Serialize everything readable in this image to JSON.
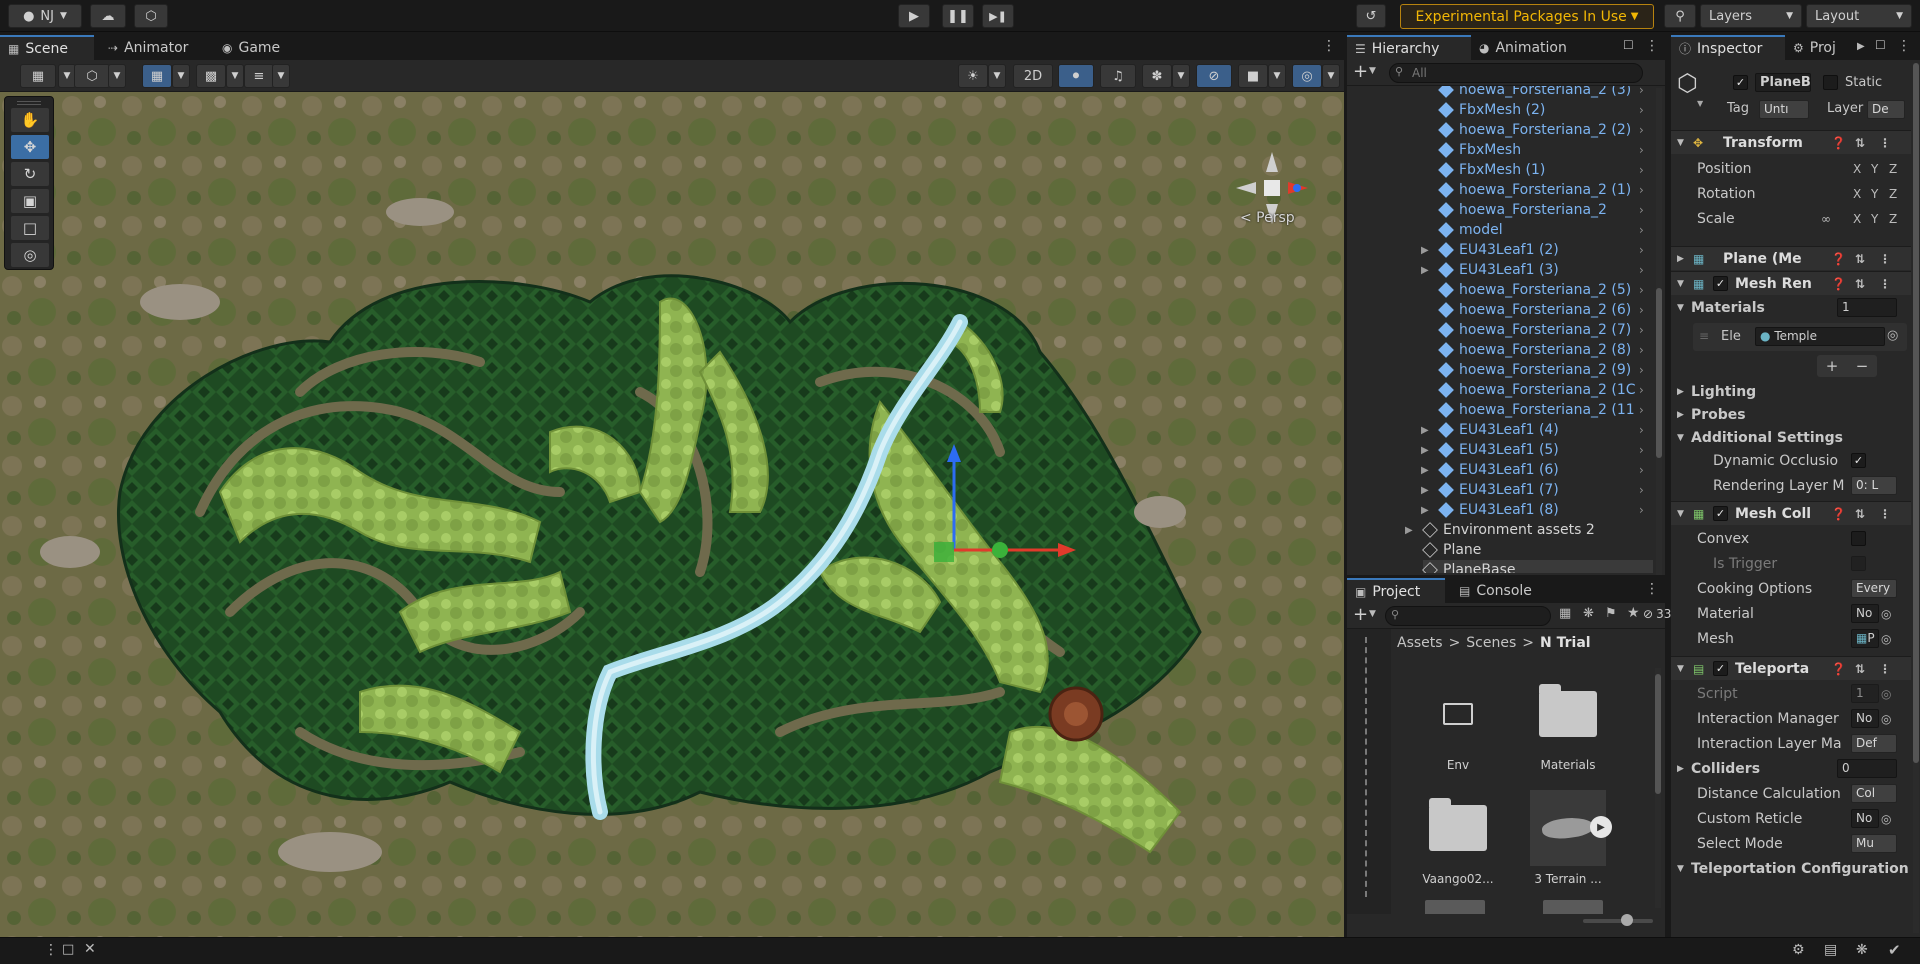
{
  "toolbar": {
    "account": "NJ",
    "experimental": "Experimental Packages In Use",
    "layers": "Layers",
    "layout": "Layout"
  },
  "scene": {
    "tabs": [
      {
        "label": "Scene",
        "icon": "scene-icon"
      },
      {
        "label": "Animator",
        "icon": "animator-icon"
      },
      {
        "label": "Game",
        "icon": "game-icon"
      }
    ],
    "mode_2d": "2D",
    "persp": "< Persp",
    "gizmo_axes": {
      "y": "y"
    }
  },
  "hierarchy": {
    "tabs": [
      "Hierarchy",
      "Animation"
    ],
    "search_placeholder": "All",
    "items": [
      {
        "label": "hoewa_Forsteriana_2 (3)",
        "type": "prefab",
        "indent": 1
      },
      {
        "label": "FbxMesh (2)",
        "type": "prefab",
        "indent": 1
      },
      {
        "label": "hoewa_Forsteriana_2 (2)",
        "type": "prefab",
        "indent": 1
      },
      {
        "label": "FbxMesh",
        "type": "prefab",
        "indent": 1
      },
      {
        "label": "FbxMesh (1)",
        "type": "prefab",
        "indent": 1
      },
      {
        "label": "hoewa_Forsteriana_2 (1)",
        "type": "prefab",
        "indent": 1
      },
      {
        "label": "hoewa_Forsteriana_2",
        "type": "prefab",
        "indent": 1
      },
      {
        "label": "model",
        "type": "prefab",
        "indent": 1
      },
      {
        "label": "EU43Leaf1 (2)",
        "type": "prefab",
        "indent": 1,
        "expandable": true
      },
      {
        "label": "EU43Leaf1 (3)",
        "type": "prefab",
        "indent": 1,
        "expandable": true
      },
      {
        "label": "hoewa_Forsteriana_2 (5)",
        "type": "prefab",
        "indent": 1
      },
      {
        "label": "hoewa_Forsteriana_2 (6)",
        "type": "prefab",
        "indent": 1
      },
      {
        "label": "hoewa_Forsteriana_2 (7)",
        "type": "prefab",
        "indent": 1
      },
      {
        "label": "hoewa_Forsteriana_2 (8)",
        "type": "prefab",
        "indent": 1
      },
      {
        "label": "hoewa_Forsteriana_2 (9)",
        "type": "prefab",
        "indent": 1
      },
      {
        "label": "hoewa_Forsteriana_2 (1C",
        "type": "prefab",
        "indent": 1
      },
      {
        "label": "hoewa_Forsteriana_2 (11",
        "type": "prefab",
        "indent": 1
      },
      {
        "label": "EU43Leaf1 (4)",
        "type": "prefab",
        "indent": 1,
        "expandable": true
      },
      {
        "label": "EU43Leaf1 (5)",
        "type": "prefab",
        "indent": 1,
        "expandable": true
      },
      {
        "label": "EU43Leaf1 (6)",
        "type": "prefab",
        "indent": 1,
        "expandable": true
      },
      {
        "label": "EU43Leaf1 (7)",
        "type": "prefab",
        "indent": 1,
        "expandable": true
      },
      {
        "label": "EU43Leaf1 (8)",
        "type": "prefab",
        "indent": 1,
        "expandable": true
      },
      {
        "label": "Environment assets 2",
        "type": "plain",
        "indent": 0,
        "expandable": true
      },
      {
        "label": "Plane",
        "type": "plain",
        "indent": 0
      },
      {
        "label": "PlaneBase",
        "type": "plain",
        "indent": 0,
        "selected": true
      }
    ]
  },
  "project": {
    "tabs": [
      "Project",
      "Console"
    ],
    "hidden_count": "33",
    "breadcrumb": [
      "Assets",
      "Scenes",
      "N Trial"
    ],
    "assets": [
      {
        "label": "Env",
        "kind": "folder-empty"
      },
      {
        "label": "Materials",
        "kind": "folder"
      },
      {
        "label": "Vaango02...",
        "kind": "folder"
      },
      {
        "label": "3 Terrain ...",
        "kind": "model"
      }
    ]
  },
  "inspector": {
    "tabs": [
      "Inspector",
      "Proj"
    ],
    "object_name": "PlaneBa",
    "static_label": "Static",
    "tag_label": "Tag",
    "tag_value": "Untı",
    "layer_label": "Layer",
    "layer_value": "De",
    "transform": {
      "title": "Transform",
      "rows": [
        "Position",
        "Rotation",
        "Scale"
      ],
      "axes": [
        "X",
        "Y",
        "Z"
      ]
    },
    "plane_mesh": "Plane (Me",
    "mesh_renderer": {
      "title": "Mesh Ren",
      "materials_label": "Materials",
      "materials_count": "1",
      "element_label": "Ele",
      "element_value": "Temple",
      "lighting": "Lighting",
      "probes": "Probes",
      "additional": "Additional Settings",
      "dynamic_occlusion": "Dynamic Occlusio",
      "rendering_layer": "Rendering Layer M",
      "rendering_layer_value": "0: L"
    },
    "mesh_collider": {
      "title": "Mesh Coll",
      "convex": "Convex",
      "is_trigger": "Is Trigger",
      "cooking": "Cooking Options",
      "cooking_value": "Every",
      "material": "Material",
      "material_value": "No",
      "mesh": "Mesh",
      "mesh_value": "P"
    },
    "teleport": {
      "title": "Teleporta",
      "script": "Script",
      "script_value": "1",
      "interaction_manager": "Interaction Manager",
      "interaction_manager_value": "No",
      "interaction_layer": "Interaction Layer Ma",
      "interaction_layer_value": "Def",
      "colliders": "Colliders",
      "colliders_value": "0",
      "distance_calc": "Distance Calculation",
      "distance_calc_value": "Col",
      "custom_reticle": "Custom Reticle",
      "custom_reticle_value": "No",
      "select_mode": "Select Mode",
      "select_mode_value": "Mu",
      "teleport_config": "Teleportation Configuration"
    }
  },
  "colors": {
    "accent": "#3a79bb",
    "warning": "#f2b705",
    "prefab_text": "#7cb3f0"
  }
}
